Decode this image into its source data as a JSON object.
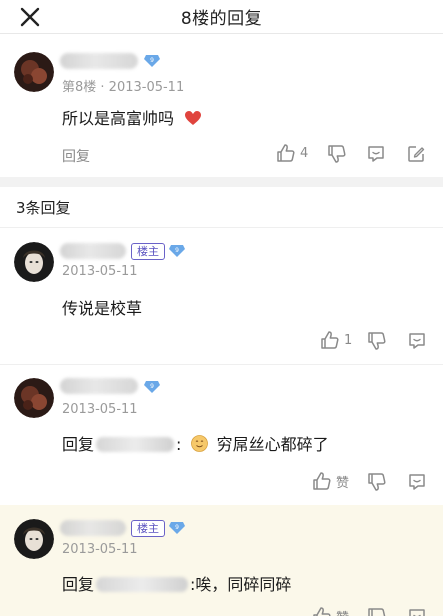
{
  "header": {
    "title": "8楼的回复"
  },
  "main_post": {
    "floor_date": "第8楼 · 2013-05-11",
    "text": "所以是高富帅吗",
    "reply_label": "回复",
    "like_count": "4"
  },
  "replies_header": "3条回复",
  "replies": [
    {
      "host_tag": "楼主",
      "date": "2013-05-11",
      "text": "传说是校草",
      "like_count": "1"
    },
    {
      "date": "2013-05-11",
      "reply_prefix": "回复",
      "colon": ":",
      "text": "穷屌丝心都碎了",
      "like_label": "赞"
    },
    {
      "host_tag": "楼主",
      "date": "2013-05-11",
      "reply_prefix": "回复",
      "text": ":唉，同碎同碎",
      "like_label": "赞"
    }
  ],
  "colors": {
    "accent_purple": "#5a52c0",
    "vip_blue": "#6aa8e8",
    "heart_red": "#e0443e",
    "highlight_bg": "#fbf8ea"
  },
  "icons": [
    "close-icon",
    "vip-badge-icon",
    "heart-emoji-icon",
    "thumbs-up-icon",
    "thumbs-down-icon",
    "comment-icon",
    "edit-icon",
    "smile-emoji-icon"
  ]
}
